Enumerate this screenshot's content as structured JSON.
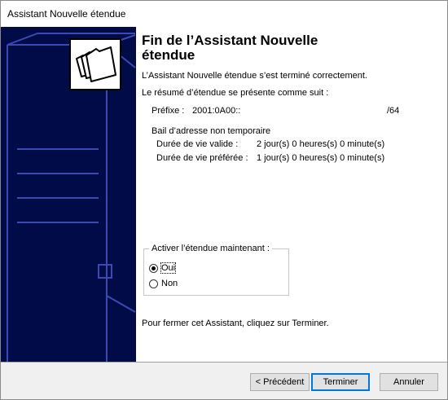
{
  "window": {
    "title": "Assistant Nouvelle étendue"
  },
  "content": {
    "heading": "Fin de l’Assistant Nouvelle étendue",
    "intro": "L’Assistant Nouvelle étendue s’est terminé correctement.",
    "summary_intro": "Le résumé d’étendue se présente comme suit :",
    "prefix_label": "Préfixe :",
    "prefix_value": "2001:0A00::",
    "prefix_length": "/64",
    "lease_title": "Bail d’adresse non temporaire",
    "valid_lifetime_label": "Durée de vie valide :",
    "valid_lifetime_value": "2 jour(s) 0 heures(s) 0 minute(s)",
    "preferred_lifetime_label": "Durée de vie préférée :",
    "preferred_lifetime_value": "1 jour(s) 0 heures(s) 0 minute(s)",
    "activate_group": {
      "label": "Activer l’étendue maintenant :",
      "options": [
        {
          "label": "Oui",
          "selected": true
        },
        {
          "label": "Non",
          "selected": false
        }
      ]
    },
    "close_hint": "Pour fermer cet Assistant, cliquez sur Terminer."
  },
  "buttons": {
    "back": "< Précédent",
    "finish": "Terminer",
    "cancel": "Annuler"
  },
  "colors": {
    "side_panel": "#000b48",
    "side_panel_lines": "#3a4ab0",
    "default_button_border": "#0078d7"
  },
  "icons": {
    "wizard_graphic": "folder-stack-icon"
  }
}
